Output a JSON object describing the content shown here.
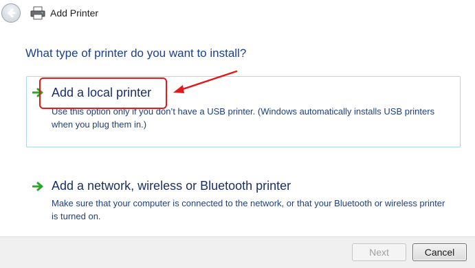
{
  "window": {
    "title": "Add Printer"
  },
  "main": {
    "heading": "What type of printer do you want to install?",
    "options": [
      {
        "title": "Add a local printer",
        "description": "Use this option only if you don’t have a USB printer. (Windows automatically installs USB printers when you plug them in.)"
      },
      {
        "title": "Add a network, wireless or Bluetooth printer",
        "description": "Make sure that your computer is connected to the network, or that your Bluetooth or wireless printer is turned on."
      }
    ]
  },
  "footer": {
    "next_label": "Next",
    "cancel_label": "Cancel"
  },
  "icons": {
    "back": "back-arrow-icon",
    "printer": "printer-icon",
    "option_arrow": "green-arrow-icon"
  },
  "colors": {
    "heading": "#1a3f8f",
    "option_text": "#1a2f66",
    "option_box_border": "#a9d6e8",
    "annotation_red": "#e31919",
    "option_arrow_green": "#2aa52a"
  }
}
